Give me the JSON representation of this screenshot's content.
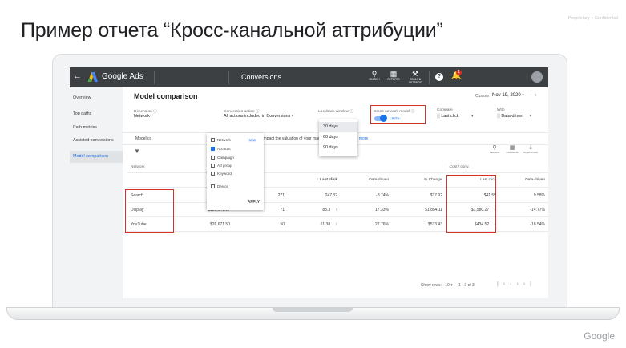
{
  "slide": {
    "title": "Пример отчета “Кросс-канальной аттрибуции”",
    "confidential": "Proprietary + Confidential",
    "footer_logo": "Google"
  },
  "topbar": {
    "back_icon": "arrow-left",
    "brand": "Google Ads",
    "page": "Conversions",
    "tools": [
      {
        "icon": "search-icon",
        "label": "SEARCH"
      },
      {
        "icon": "reports-icon",
        "label": "REPORTS"
      },
      {
        "icon": "wrench-icon",
        "label": "TOOLS & SETTINGS"
      }
    ],
    "notification_count": "1"
  },
  "sidebar": {
    "items": [
      {
        "label": "Overview"
      },
      {
        "label": "Top paths"
      },
      {
        "label": "Path metrics"
      },
      {
        "label": "Assisted conversions"
      },
      {
        "label": "Model comparison"
      }
    ],
    "active_index": 4
  },
  "header": {
    "title": "Model comparison",
    "custom_label": "Custom",
    "date_range": "Nov 19, 2020"
  },
  "controls": {
    "dimension_label": "Dimension",
    "dimension_value": "Network",
    "conversion_action_label": "Conversion action",
    "conversion_action_value": "All actions included in Conversions",
    "lookback_label": "Lookback window",
    "cross_network_label": "Cross-network model",
    "cross_network_badge": "BETA",
    "compare_label": "Compare",
    "compare_value": "Last click",
    "with_label": "With",
    "with_value": "Data-driven"
  },
  "notice": {
    "prefix": "Model co",
    "text": "nt attribution models impact the valuation of your market",
    "link": "rn more"
  },
  "actions": [
    {
      "icon": "columns-search-icon",
      "label": "SEARCH"
    },
    {
      "icon": "columns-icon",
      "label": "COLUMNS"
    },
    {
      "icon": "download-icon",
      "label": "DOWNLOAD"
    }
  ],
  "table": {
    "group_headers": {
      "network": "Network",
      "cost": "Cost",
      "conversions": "Conversions",
      "cost_conv": "Cost / conv."
    },
    "columns": {
      "last_click": "Last click",
      "data_driven": "Data-driven",
      "change": "% Change",
      "last_click2": "Last click",
      "data_driven2": "Data-driven",
      "change2": "% Change"
    },
    "rows": [
      {
        "network": "Search",
        "cost": "$10,276.38",
        "conv_last": "271",
        "conv_dd": "247.32",
        "conv_change": "-8.74%",
        "cpa_last": "$37.92",
        "cpa_dd": "$41.55",
        "cpa_change": "9.58%"
      },
      {
        "network": "Display",
        "cost": "$131,641.97",
        "conv_last": "71",
        "conv_dd": "83.3",
        "conv_change": "17.33%",
        "cpa_last": "$1,854.11",
        "cpa_dd": "$1,580.27",
        "cpa_change": "-14.77%"
      },
      {
        "network": "YouTube",
        "cost": "$26,671.50",
        "conv_last": "50",
        "conv_dd": "61.38",
        "conv_change": "22.76%",
        "cpa_last": "$533.43",
        "cpa_dd": "$434.52",
        "cpa_change": "-18.54%"
      }
    ]
  },
  "pagination": {
    "show_rows_label": "Show rows:",
    "rows_value": "10",
    "range": "1 - 3 of 3"
  },
  "dimension_menu": {
    "items": [
      {
        "label": "Network",
        "checked": false
      },
      {
        "label": "Account",
        "checked": true
      },
      {
        "label": "Campaign",
        "checked": false
      },
      {
        "label": "Ad group",
        "checked": false
      },
      {
        "label": "Keyword",
        "checked": false
      },
      {
        "label": "Device",
        "checked": false
      }
    ],
    "new_badge": "NEW",
    "apply": "APPLY"
  },
  "lookback_menu": {
    "options": [
      "30 days",
      "60 days",
      "90 days"
    ],
    "selected_index": 0
  },
  "colors": {
    "accent": "#1a73e8",
    "highlight": "#d93025",
    "topbar": "#3c4043"
  }
}
